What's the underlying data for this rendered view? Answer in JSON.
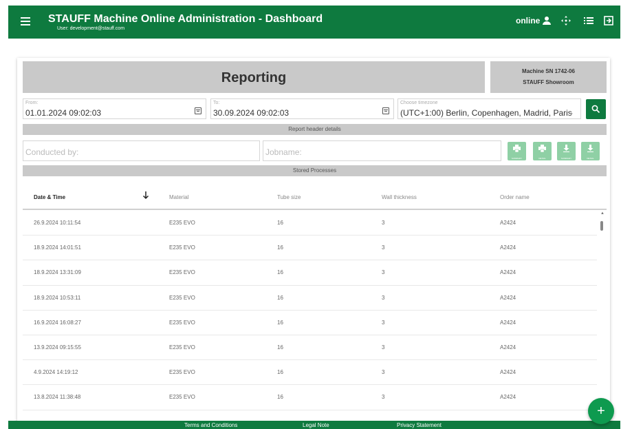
{
  "header": {
    "title": "STAUFF Machine Online Administration - Dashboard",
    "user": "User: development@stauff.com",
    "status": "online",
    "icons": [
      "menu-icon",
      "person-icon",
      "move-icon",
      "list-icon",
      "logout-icon"
    ]
  },
  "report": {
    "title": "Reporting",
    "machine_sn": "Machine SN 1742-06",
    "machine_location": "STAUFF Showroom"
  },
  "filters": {
    "from_label": "From:",
    "from_value": "01.01.2024 09:02:03",
    "to_label": "To:",
    "to_value": "30.09.2024 09:02:03",
    "timezone_label": "Choose timezone",
    "timezone_value": "(UTC+1:00) Berlin, Copenhagen, Madrid, Paris"
  },
  "report_header": {
    "section_title": "Report header details",
    "conducted_by_placeholder": "Conducted by:",
    "jobname_placeholder": "Jobname:",
    "buttons": [
      "SUMMARY",
      "DETAIL",
      "SUMMARY",
      "DETAIL"
    ]
  },
  "processes": {
    "section_title": "Stored Processes",
    "columns": [
      "Date & Time",
      "Material",
      "Tube size",
      "Wall thickness",
      "Order name"
    ],
    "rows": [
      [
        "26.9.2024 10:11:54",
        "E235 EVO",
        "16",
        "3",
        "A2424"
      ],
      [
        "18.9.2024 14:01:51",
        "E235 EVO",
        "16",
        "3",
        "A2424"
      ],
      [
        "18.9.2024 13:31:09",
        "E235 EVO",
        "16",
        "3",
        "A2424"
      ],
      [
        "18.9.2024 10:53:11",
        "E235 EVO",
        "16",
        "3",
        "A2424"
      ],
      [
        "16.9.2024 16:08:27",
        "E235 EVO",
        "16",
        "3",
        "A2424"
      ],
      [
        "13.9.2024 09:15:55",
        "E235 EVO",
        "16",
        "3",
        "A2424"
      ],
      [
        "4.9.2024 14:19:12",
        "E235 EVO",
        "16",
        "3",
        "A2424"
      ],
      [
        "13.8.2024 11:38:48",
        "E235 EVO",
        "16",
        "3",
        "A2424"
      ]
    ]
  },
  "footer": {
    "terms": "Terms and Conditions",
    "legal": "Legal Note",
    "privacy": "Privacy Statement"
  },
  "fab_label": "+",
  "colors": {
    "brand_green": "#0e7a3f",
    "button_light_green": "#8fd0a5",
    "section_gray": "#c9c9c9"
  }
}
